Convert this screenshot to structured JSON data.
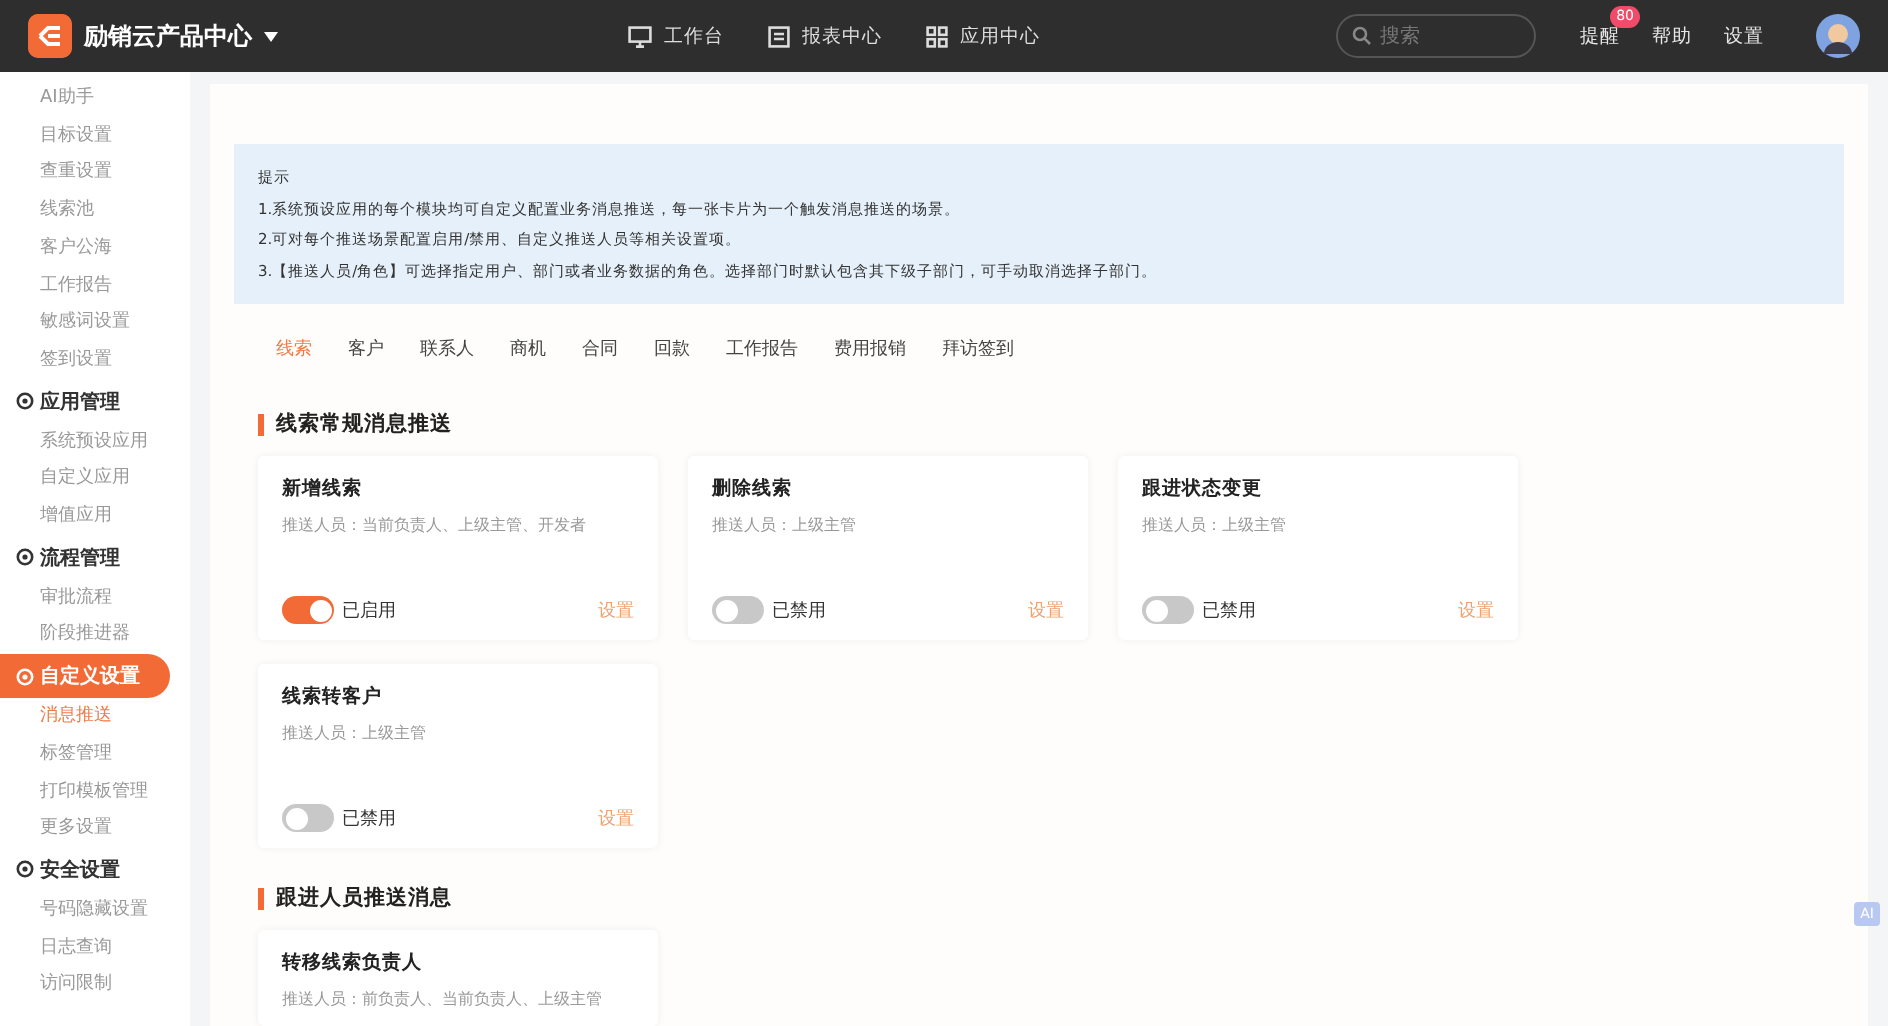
{
  "topbar": {
    "brand": "励销云产品中心",
    "nav": [
      {
        "label": "工作台"
      },
      {
        "label": "报表中心"
      },
      {
        "label": "应用中心"
      }
    ],
    "search": {
      "placeholder": "搜索"
    },
    "links": [
      {
        "label": "提醒",
        "badge": "80"
      },
      {
        "label": "帮助"
      },
      {
        "label": "设置"
      }
    ]
  },
  "sidebar": {
    "groups": [
      {
        "items": [
          {
            "label": "AI助手",
            "selected": false
          },
          {
            "label": "目标设置",
            "selected": false
          },
          {
            "label": "查重设置",
            "selected": false
          },
          {
            "label": "线索池",
            "selected": false
          },
          {
            "label": "客户公海",
            "selected": false
          },
          {
            "label": "工作报告",
            "selected": false
          },
          {
            "label": "敏感词设置",
            "selected": false
          },
          {
            "label": "签到设置",
            "selected": false
          }
        ]
      },
      {
        "title": "应用管理",
        "active": false,
        "items": [
          {
            "label": "系统预设应用",
            "selected": false
          },
          {
            "label": "自定义应用",
            "selected": false
          },
          {
            "label": "增值应用",
            "selected": false
          }
        ]
      },
      {
        "title": "流程管理",
        "active": false,
        "items": [
          {
            "label": "审批流程",
            "selected": false
          },
          {
            "label": "阶段推进器",
            "selected": false
          }
        ]
      },
      {
        "title": "自定义设置",
        "active": true,
        "items": [
          {
            "label": "消息推送",
            "selected": true
          },
          {
            "label": "标签管理",
            "selected": false
          },
          {
            "label": "打印模板管理",
            "selected": false
          },
          {
            "label": "更多设置",
            "selected": false
          }
        ]
      },
      {
        "title": "安全设置",
        "active": false,
        "items": [
          {
            "label": "号码隐藏设置",
            "selected": false
          },
          {
            "label": "日志查询",
            "selected": false
          },
          {
            "label": "访问限制",
            "selected": false
          }
        ]
      }
    ]
  },
  "notice": {
    "title": "提示",
    "lines": [
      "1.系统预设应用的每个模块均可自定义配置业务消息推送，每一张卡片为一个触发消息推送的场景。",
      "2.可对每个推送场景配置启用/禁用、自定义推送人员等相关设置项。",
      "3.【推送人员/角色】可选择指定用户、部门或者业务数据的角色。选择部门时默认包含其下级子部门，可手动取消选择子部门。"
    ]
  },
  "tabs": [
    {
      "label": "线索",
      "selected": true
    },
    {
      "label": "客户",
      "selected": false
    },
    {
      "label": "联系人",
      "selected": false
    },
    {
      "label": "商机",
      "selected": false
    },
    {
      "label": "合同",
      "selected": false
    },
    {
      "label": "回款",
      "selected": false
    },
    {
      "label": "工作报告",
      "selected": false
    },
    {
      "label": "费用报销",
      "selected": false
    },
    {
      "label": "拜访签到",
      "selected": false
    }
  ],
  "sections": [
    {
      "title": "线索常规消息推送",
      "cards": [
        {
          "title": "新增线索",
          "recipients": "推送人员：当前负责人、上级主管、开发者",
          "enabled": true,
          "status": "已启用",
          "action": "设置"
        },
        {
          "title": "删除线索",
          "recipients": "推送人员：上级主管",
          "enabled": false,
          "status": "已禁用",
          "action": "设置"
        },
        {
          "title": "跟进状态变更",
          "recipients": "推送人员：上级主管",
          "enabled": false,
          "status": "已禁用",
          "action": "设置"
        },
        {
          "title": "线索转客户",
          "recipients": "推送人员：上级主管",
          "enabled": false,
          "status": "已禁用",
          "action": "设置"
        }
      ]
    },
    {
      "title": "跟进人员推送消息",
      "cards": [
        {
          "title": "转移线索负责人",
          "recipients": "推送人员：前负责人、当前负责人、上级主管"
        }
      ]
    }
  ],
  "ai_button": "AI"
}
